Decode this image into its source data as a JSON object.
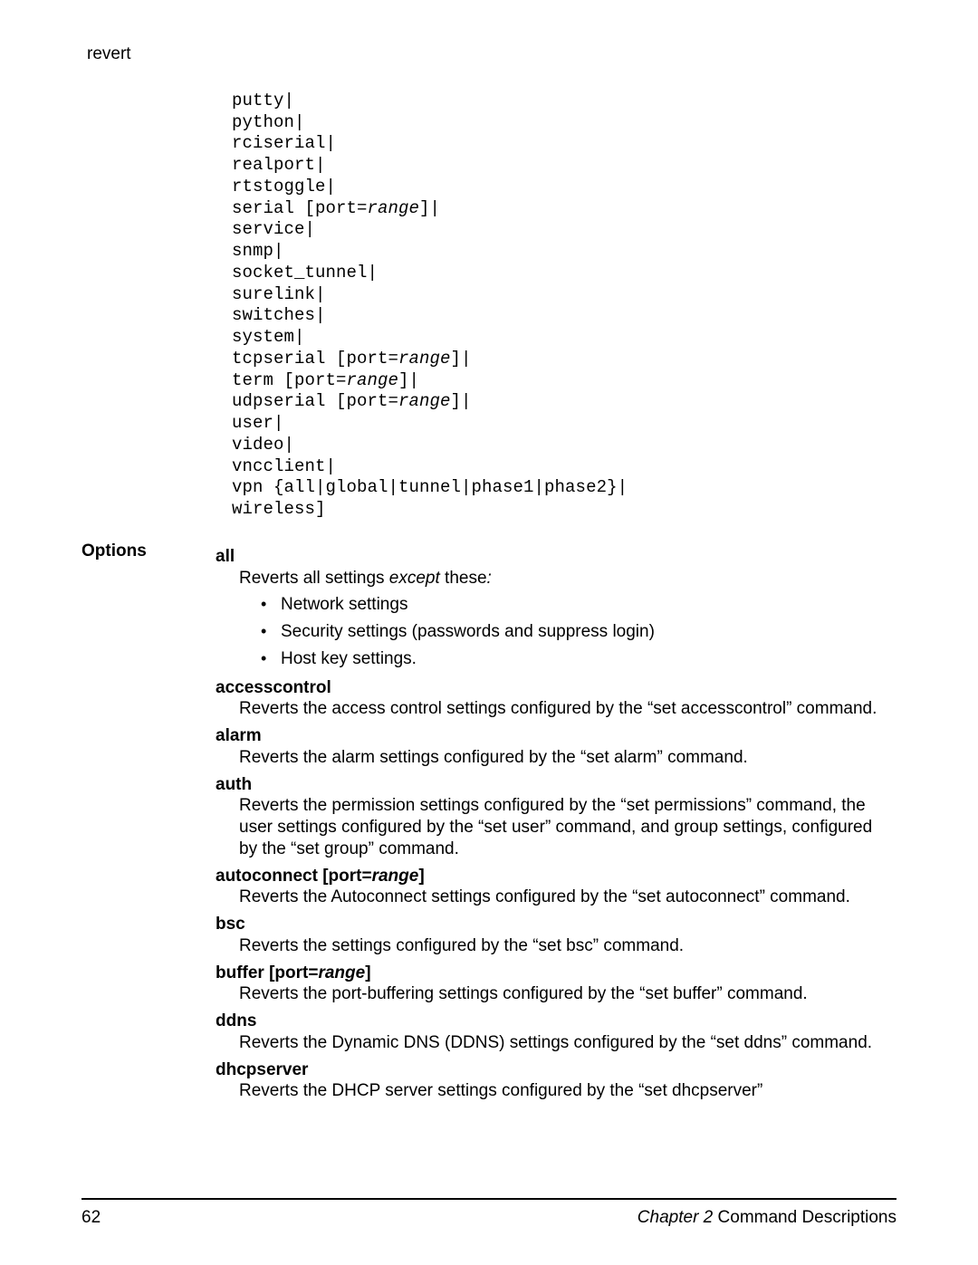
{
  "running_head": "revert",
  "code_lines": [
    {
      "t": "putty|"
    },
    {
      "t": "python|"
    },
    {
      "t": "rciserial|"
    },
    {
      "t": "realport|"
    },
    {
      "t": "rtstoggle|"
    },
    {
      "pre": "serial [port=",
      "it": "range",
      "post": "]|"
    },
    {
      "t": "service|"
    },
    {
      "t": "snmp|"
    },
    {
      "t": "socket_tunnel|"
    },
    {
      "t": "surelink|"
    },
    {
      "t": "switches|"
    },
    {
      "t": "system|"
    },
    {
      "pre": "tcpserial [port=",
      "it": "range",
      "post": "]|"
    },
    {
      "pre": "term [port=",
      "it": "range",
      "post": "]|"
    },
    {
      "pre": "udpserial [port=",
      "it": "range",
      "post": "]|"
    },
    {
      "t": "user|"
    },
    {
      "t": "video|"
    },
    {
      "t": "vncclient|"
    },
    {
      "t": "vpn {all|global|tunnel|phase1|phase2}|"
    },
    {
      "t": "wireless]"
    }
  ],
  "section_label": "Options",
  "options": {
    "all": {
      "head": "all",
      "intro_pre": "Reverts all settings ",
      "intro_it": "except",
      "intro_post": " these",
      "intro_colon_it": ":",
      "bullets": [
        "Network settings",
        "Security settings (passwords and suppress login)",
        "Host key settings."
      ]
    },
    "accesscontrol": {
      "head": "accesscontrol",
      "body": "Reverts the access control settings configured by the “set accesscontrol” command."
    },
    "alarm": {
      "head": "alarm",
      "body": "Reverts the alarm settings configured by the “set alarm” command."
    },
    "auth": {
      "head": "auth",
      "body": "Reverts the permission settings configured by the “set permissions” command, the user settings configured by the “set user” command, and group settings, configured by the “set group” command."
    },
    "autoconnect": {
      "head_pre": "autoconnect [port=",
      "head_it": "range",
      "head_post": "]",
      "body": "Reverts the Autoconnect settings configured by the “set autoconnect” command."
    },
    "bsc": {
      "head": "bsc",
      "body": "Reverts the settings configured by the “set bsc” command."
    },
    "buffer": {
      "head_pre": "buffer [port=",
      "head_it": "range",
      "head_post": "]",
      "body": "Reverts the port-buffering settings configured by the “set buffer” command."
    },
    "ddns": {
      "head": "ddns",
      "body": "Reverts the Dynamic DNS (DDNS) settings configured by the “set ddns” command."
    },
    "dhcpserver": {
      "head": "dhcpserver",
      "body": "Reverts the DHCP server settings configured by the “set dhcpserver”"
    }
  },
  "footer": {
    "page_num": "62",
    "chapter_it": "Chapter 2",
    "chapter_rest": "   Command Descriptions"
  }
}
